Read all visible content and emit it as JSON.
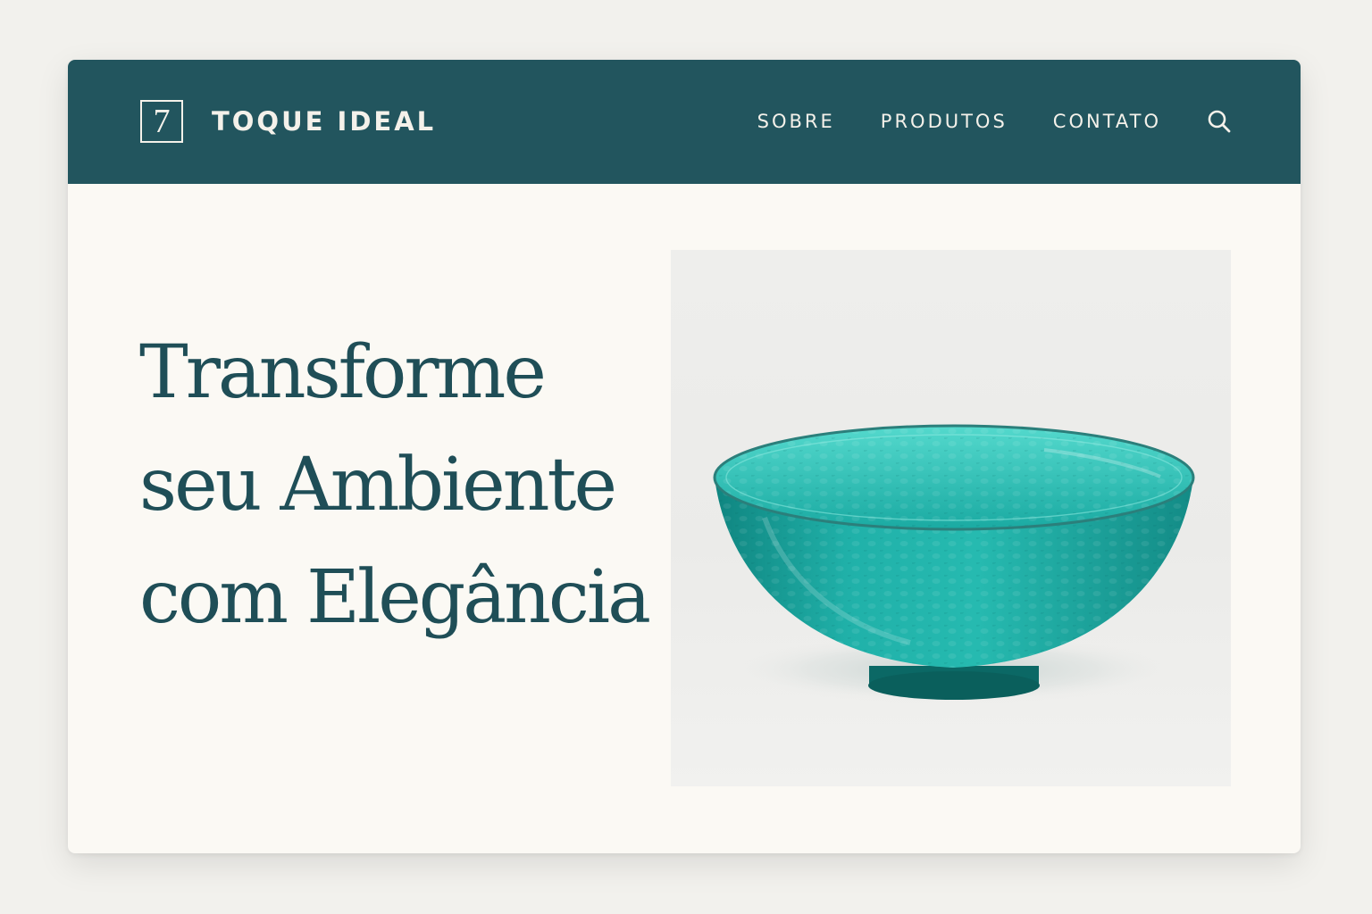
{
  "brand": {
    "logo_mark": "7",
    "name": "TOQUE IDEAL"
  },
  "nav": {
    "items": [
      {
        "label": "SOBRE"
      },
      {
        "label": "PRODUTOS"
      },
      {
        "label": "CONTATO"
      }
    ],
    "search_icon": "search-icon"
  },
  "hero": {
    "title_lines": [
      "Transforme",
      "seu Ambiente",
      "com Elegância"
    ],
    "image": {
      "subject": "teal-glass-bowl",
      "colors": {
        "bowl": "#1fb3aa",
        "bowl_dark": "#0f7f7b",
        "background": "#ececea"
      }
    }
  },
  "colors": {
    "primary": "#22555e",
    "page_background": "#fbf9f4",
    "outer_background": "#f2f1ed",
    "header_text": "#f4f1ea",
    "title_text": "#1f4e57"
  }
}
